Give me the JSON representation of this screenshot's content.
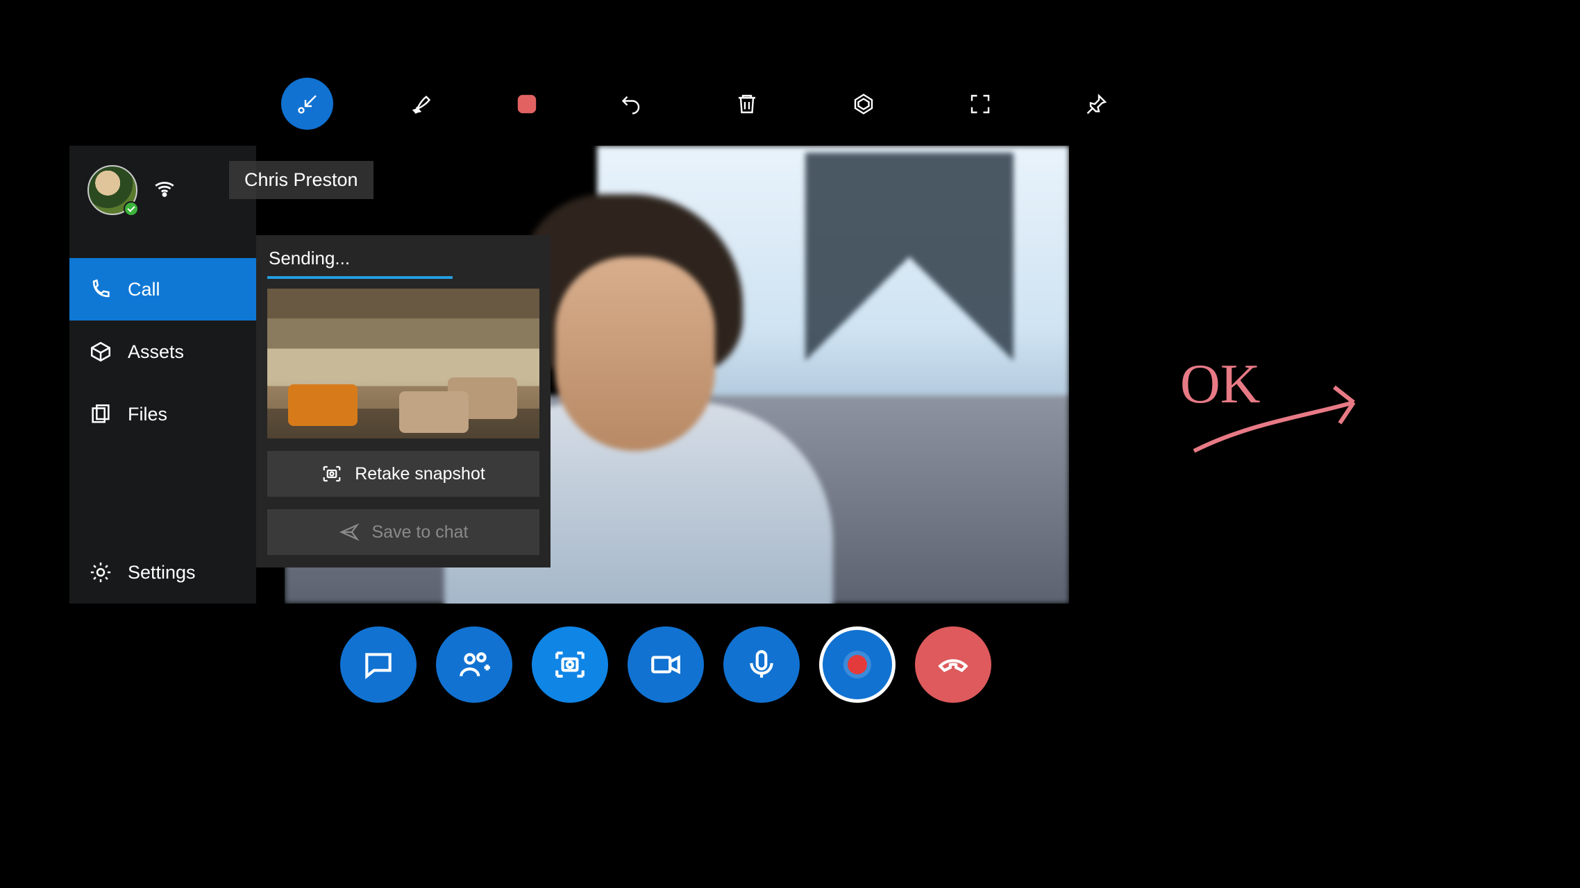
{
  "toolbar": {
    "items": [
      {
        "name": "snip-collapse-button",
        "icon": "arrow-in-icon",
        "active": true
      },
      {
        "name": "pen-button",
        "icon": "pen-icon"
      },
      {
        "name": "stop-record-button",
        "icon": "stop-square-icon"
      },
      {
        "name": "undo-button",
        "icon": "undo-icon"
      },
      {
        "name": "delete-button",
        "icon": "trash-icon"
      },
      {
        "name": "shapes-button",
        "icon": "hex-icon"
      },
      {
        "name": "fullscreen-button",
        "icon": "expand-icon"
      },
      {
        "name": "pin-button",
        "icon": "pin-icon"
      }
    ]
  },
  "call": {
    "participant_name": "Chris Preston"
  },
  "sidebar": {
    "items": [
      {
        "label": "Call",
        "icon": "phone-icon",
        "selected": true
      },
      {
        "label": "Assets",
        "icon": "box-icon"
      },
      {
        "label": "Files",
        "icon": "files-icon"
      },
      {
        "label": "Settings",
        "icon": "gear-icon"
      }
    ]
  },
  "snapshot_panel": {
    "status": "Sending...",
    "progress_pct": 68,
    "retake_label": "Retake snapshot",
    "save_label": "Save to chat"
  },
  "call_controls": [
    {
      "name": "chat-button",
      "icon": "chat-icon"
    },
    {
      "name": "add-participant-button",
      "icon": "people-add-icon"
    },
    {
      "name": "snapshot-button",
      "icon": "snapshot-icon",
      "highlight": true
    },
    {
      "name": "video-button",
      "icon": "video-icon"
    },
    {
      "name": "mic-button",
      "icon": "mic-icon"
    },
    {
      "name": "record-button",
      "icon": "record-icon"
    },
    {
      "name": "hangup-button",
      "icon": "hangup-icon",
      "style": "red"
    }
  ],
  "annotation": {
    "text": "OK"
  },
  "colors": {
    "accent": "#1172d2",
    "accent_bright": "#0f85e6",
    "danger": "#de5a5c",
    "ink": "#e87a86"
  }
}
